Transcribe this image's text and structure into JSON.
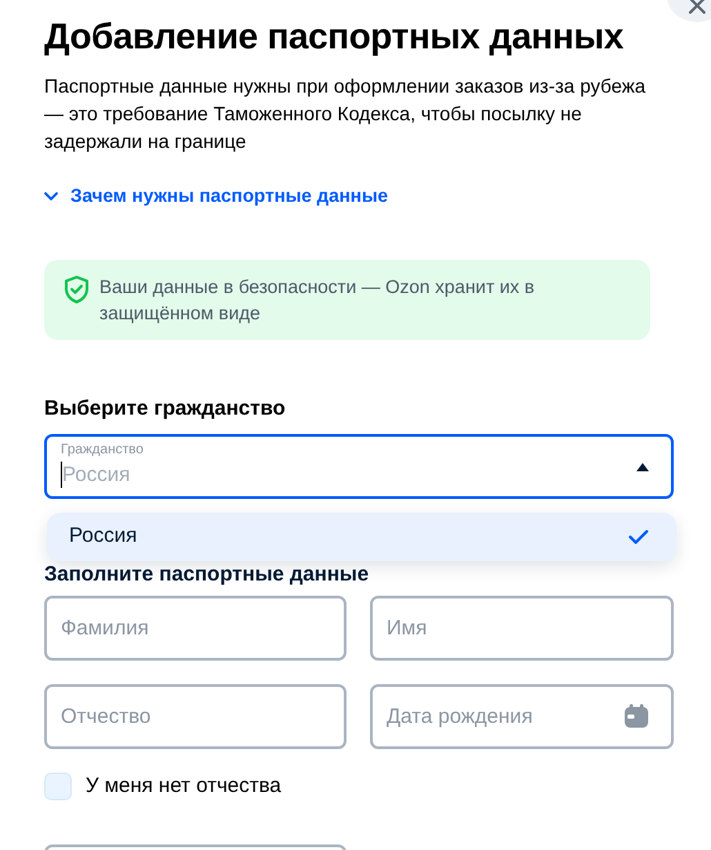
{
  "title": "Добавление паспортных данных",
  "description": "Паспортные данные нужны при оформлении заказов из-за рубежа — это требование Таможенного Кодекса, чтобы посылку не задержали на границе",
  "info_link": {
    "label": "Зачем нужны паспортные данные",
    "expanded": false
  },
  "security_note": "Ваши данные в безопасности — Ozon хранит их в защищённом виде",
  "citizenship": {
    "heading": "Выберите гражданство",
    "field": {
      "label": "Гражданство",
      "placeholder": "Россия",
      "open": true
    },
    "options": [
      {
        "label": "Россия",
        "selected": true
      }
    ]
  },
  "passport": {
    "heading": "Заполните паспортные данные",
    "fields": [
      {
        "placeholder": "Фамилия",
        "kind": "text"
      },
      {
        "placeholder": "Имя",
        "kind": "text"
      },
      {
        "placeholder": "Отчество",
        "kind": "text"
      },
      {
        "placeholder": "Дата рождения",
        "kind": "date"
      }
    ],
    "checkbox": {
      "label": "У меня нет отчества",
      "checked": false
    },
    "more_fields": [
      {
        "kind": "text"
      }
    ]
  }
}
